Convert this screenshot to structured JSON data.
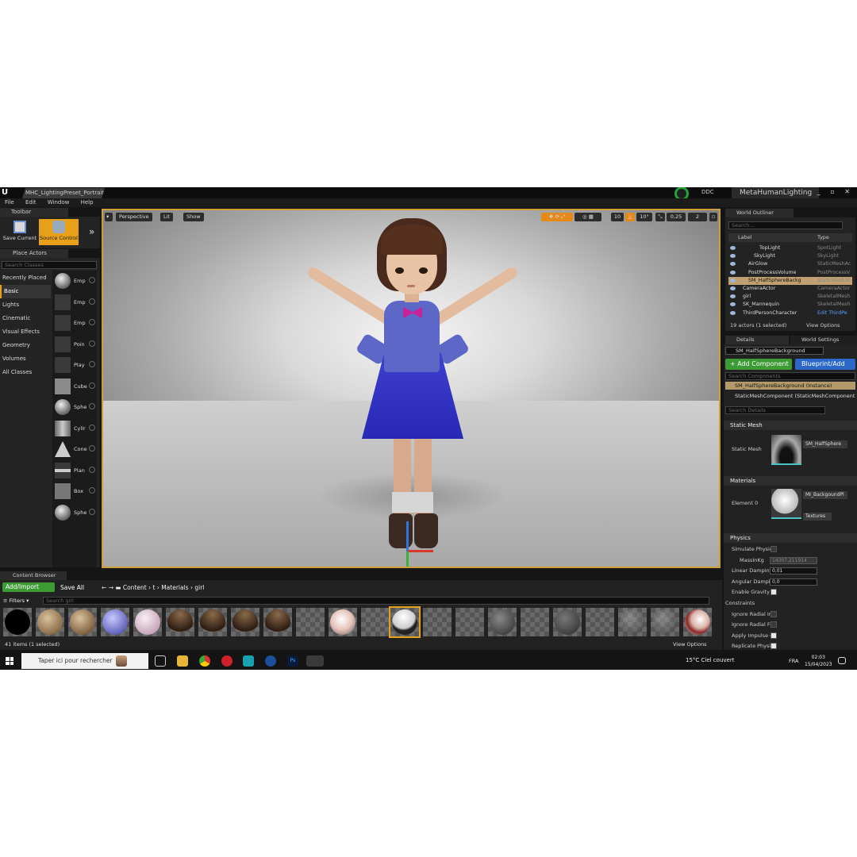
{
  "window": {
    "doc_tab": "MHC_LightingPreset_Portrait",
    "ddc_label": "DDC",
    "project_name": "MetaHumanLighting",
    "controls": "_ ▫ ✕"
  },
  "menu": [
    "File",
    "Edit",
    "Window",
    "Help"
  ],
  "toolbar": {
    "tab_label": "Toolbar",
    "save_current": "Save Current",
    "source_control": "Source Control",
    "more": "»"
  },
  "place_actors": {
    "tab_label": "Place Actors",
    "search_placeholder": "Search Classes",
    "categories": [
      "Recently Placed",
      "Basic",
      "Lights",
      "Cinematic",
      "Visual Effects",
      "Geometry",
      "Volumes",
      "All Classes"
    ],
    "active_category": "Basic",
    "items": [
      "Emp",
      "Emp",
      "Emp",
      "Poin",
      "Play",
      "Cube",
      "Sphe",
      "Cylir",
      "Cone",
      "Plan",
      "Box",
      "Sphe"
    ]
  },
  "viewport": {
    "perspective": "Perspective",
    "lit": "Lit",
    "show": "Show",
    "grid_snap": "10",
    "rotation_snap": "10°",
    "scale_snap": "0,25",
    "camera_speed": "2"
  },
  "world_outliner": {
    "tab_label": "World Outliner",
    "search_placeholder": "Search...",
    "col_label": "Label",
    "col_type": "Type",
    "rows": [
      {
        "label": "TopLight",
        "type": "SpotLight",
        "indent": 3,
        "selected": false,
        "link": false
      },
      {
        "label": "SkyLight",
        "type": "SkyLight",
        "indent": 2,
        "selected": false,
        "link": false
      },
      {
        "label": "AirGlow",
        "type": "StaticMeshAc",
        "indent": 1,
        "selected": false,
        "link": false
      },
      {
        "label": "PostProcessVolume",
        "type": "PostProcessV",
        "indent": 1,
        "selected": false,
        "link": false
      },
      {
        "label": "SM_HalfSphereBackg",
        "type": "StaticMeshAc",
        "indent": 1,
        "selected": true,
        "link": false
      },
      {
        "label": "CameraActor",
        "type": "CameraActor",
        "indent": 0,
        "selected": false,
        "link": false
      },
      {
        "label": "girl",
        "type": "SkeletalMesh",
        "indent": 0,
        "selected": false,
        "link": false
      },
      {
        "label": "SK_Mannequin",
        "type": "SkeletalMesh",
        "indent": 0,
        "selected": false,
        "link": false
      },
      {
        "label": "ThirdPersonCharacter",
        "type": "Edit ThirdPe",
        "indent": 0,
        "selected": false,
        "link": true
      }
    ],
    "footer": "19 actors (1 selected)",
    "view_options": "View Options"
  },
  "details": {
    "tab_label": "Details",
    "world_settings_tab": "World Settings",
    "object_name": "SM_HalfSphereBackground",
    "add_component": "+ Add Component",
    "blueprint": "Blueprint/Add",
    "search_components": "Search Components",
    "instance": "SM_HalfSphereBackground (Instance)",
    "component": "StaticMeshComponent (StaticMeshComponent",
    "search_details": "Search Details",
    "static_mesh_section": "Static Mesh",
    "static_mesh_label": "Static Mesh",
    "static_mesh_value": "SM_HalfSphere",
    "materials_section": "Materials",
    "element0_label": "Element 0",
    "element0_value": "MI_BackgoundPl",
    "textures_label": "Textures",
    "physics_section": "Physics",
    "physics_props": [
      {
        "label": "Simulate Physic",
        "kind": "check",
        "value": "false"
      },
      {
        "label": "MassInKg",
        "kind": "field",
        "value": "14307,211914"
      },
      {
        "label": "Linear Damping",
        "kind": "field",
        "value": "0,01"
      },
      {
        "label": "Angular Dampin",
        "kind": "field",
        "value": "0,0"
      },
      {
        "label": "Enable Gravity",
        "kind": "check",
        "value": "true"
      },
      {
        "label": "Constraints",
        "kind": "group",
        "value": ""
      },
      {
        "label": "Ignore Radial Im",
        "kind": "check",
        "value": "false"
      },
      {
        "label": "Ignore Radial Fo",
        "kind": "check",
        "value": "false"
      },
      {
        "label": "Apply Impulse o",
        "kind": "check",
        "value": "true"
      },
      {
        "label": "Replicate Physi",
        "kind": "check",
        "value": "true"
      }
    ]
  },
  "content_browser": {
    "tab_label": "Content Browser",
    "add_import": "Add/Import",
    "save_all": "Save All",
    "path": [
      "Content",
      "t",
      "Materials",
      "girl"
    ],
    "filters": "Filters",
    "search_placeholder": "Search girl",
    "count": "41 items (1 selected)",
    "view_options": "View Options"
  },
  "taskbar": {
    "search_placeholder": "Taper ici pour rechercher",
    "weather": "15°C  Ciel couvert",
    "language": "FRA",
    "time": "02:03",
    "date": "15/04/2023"
  }
}
